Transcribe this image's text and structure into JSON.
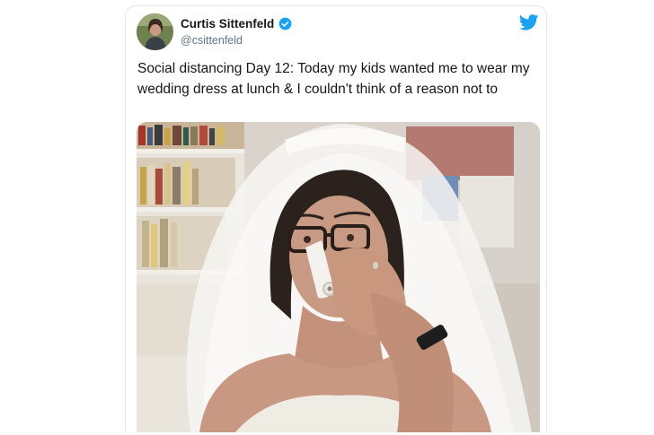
{
  "tweet": {
    "author_name": "Curtis Sittenfeld",
    "handle": "@csittenfeld",
    "text": "Social distancing Day 12: Today my kids wanted me to wear my wedding dress at lunch & I couldn't think of a reason not to",
    "verified": true
  },
  "icons": {
    "brand": "twitter-bird-icon",
    "verified": "verified-badge-icon"
  },
  "colors": {
    "twitter_blue": "#1da1f2",
    "text_primary": "#14171a",
    "text_secondary": "#657786",
    "border": "#e1e8ed"
  }
}
